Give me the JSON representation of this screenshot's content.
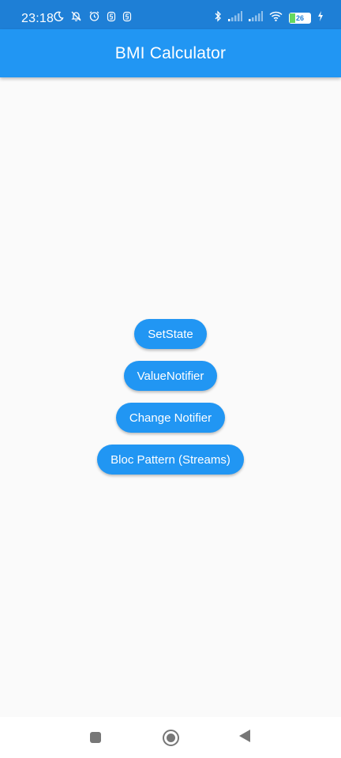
{
  "status_bar": {
    "time": "23:18",
    "battery_level": "26",
    "battery_fraction": 0.26,
    "left_icons": [
      "moon-icon",
      "bell-off-icon",
      "alarm-icon",
      "notification-icon",
      "notification-icon"
    ],
    "right_icons": [
      "bluetooth-icon",
      "signal-icon",
      "signal-icon",
      "wifi-icon",
      "battery-icon",
      "charging-icon"
    ]
  },
  "app_bar": {
    "title": "BMI Calculator"
  },
  "buttons": {
    "setstate": "SetState",
    "valuenotifier": "ValueNotifier",
    "changenotifier": "Change Notifier",
    "bloc": "Bloc Pattern (Streams)"
  },
  "nav_bar": {
    "icons": [
      "recents-square-icon",
      "home-circle-icon",
      "back-triangle-icon"
    ]
  },
  "colors": {
    "primary": "#2196f3",
    "status_bar": "#1e7fd6",
    "background": "#fafafa"
  }
}
